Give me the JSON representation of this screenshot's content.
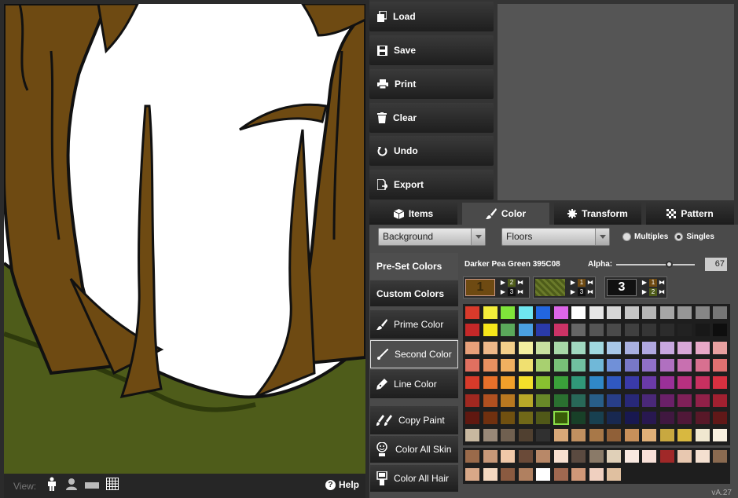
{
  "actions": {
    "load": "Load",
    "save": "Save",
    "print": "Print",
    "clear": "Clear",
    "undo": "Undo",
    "export": "Export"
  },
  "tabs": [
    {
      "label": "Items",
      "icon": "cube-icon"
    },
    {
      "label": "Color",
      "icon": "paint-brush-icon",
      "active": true
    },
    {
      "label": "Transform",
      "icon": "gear-icon"
    },
    {
      "label": "Pattern",
      "icon": "checker-pattern-icon"
    }
  ],
  "selects": {
    "layer": "Background",
    "category": "Floors"
  },
  "radios": {
    "multiples": "Multiples",
    "singles": "Singles",
    "selected": "Singles"
  },
  "side": {
    "preset": "Pre-Set Colors",
    "custom": "Custom Colors",
    "prime": "Prime Color",
    "second": "Second Color",
    "line": "Line Color",
    "copy": "Copy Paint",
    "skin": "Color All Skin",
    "hair": "Color All Hair"
  },
  "color_info": {
    "name": "Darker Pea Green 395C08",
    "alpha_label": "Alpha:",
    "alpha_value": "67",
    "alpha_fraction": 0.67
  },
  "slots": [
    "1",
    "2",
    "3"
  ],
  "view": {
    "label": "View:",
    "help": "Help"
  },
  "version": "vA.27",
  "colors": {
    "canvas_green": "#4e5c1a",
    "bark": "#6e4a12",
    "selected_swatch": "#395C08"
  },
  "palette_rows": [
    [
      "#d93a2b",
      "#f4ee3a",
      "#7fe53a",
      "#6fe7f0",
      "#2266e0",
      "#dd66e8",
      "#ffffff",
      "#e6e6e6",
      "#d6d6d6",
      "#c6c6c6",
      "#b6b6b6",
      "#a6a6a6",
      "#969696",
      "#868686",
      "#767676"
    ],
    [
      "#c62828",
      "#f6e61a",
      "#5aa85a",
      "#4aa0e0",
      "#2a3aa8",
      "#cc3366",
      "#666666",
      "#555555",
      "#4a4a4a",
      "#404040",
      "#363636",
      "#2c2c2c",
      "#222222",
      "#181818",
      "#0e0e0e"
    ],
    [
      "#e8a07a",
      "#eeb88a",
      "#f4d08a",
      "#f4f0a0",
      "#c8e0a0",
      "#a8d8a8",
      "#a0d8c0",
      "#a0d8e0",
      "#a8c8e8",
      "#a8b0e0",
      "#b0a8e0",
      "#c8a8e0",
      "#d8a8d8",
      "#e8a8c8",
      "#e8a0a0"
    ],
    [
      "#e07060",
      "#e89060",
      "#f0b060",
      "#f0e070",
      "#a8d070",
      "#78c078",
      "#70c0a0",
      "#70b8d8",
      "#7090d8",
      "#7878c8",
      "#9070c8",
      "#b070c0",
      "#c870b0",
      "#d87090",
      "#e07070"
    ],
    [
      "#d83a2a",
      "#e8702a",
      "#f0a02a",
      "#f4e02a",
      "#88c030",
      "#3aa03a",
      "#309878",
      "#3088c8",
      "#3058c0",
      "#3a3aa8",
      "#6a3aa8",
      "#9a3098",
      "#b83080",
      "#c83060",
      "#d83040"
    ],
    [
      "#a02820",
      "#b05020",
      "#b87820",
      "#b8a828",
      "#688828",
      "#2a7030",
      "#286858",
      "#285e88",
      "#283e88",
      "#282878",
      "#4a2878",
      "#6a2068",
      "#802058",
      "#902048",
      "#a02030"
    ],
    [
      "#601810",
      "#70300f",
      "#705010",
      "#706818",
      "#505818",
      "#395c08",
      "#184028",
      "#184050",
      "#182850",
      "#181850",
      "#281850",
      "#401840",
      "#501838",
      "#581828",
      "#601818"
    ],
    [
      "#c8b8a0",
      "#988878",
      "#706050",
      "#504030",
      "#303030",
      "#d8a878",
      "#c09060",
      "#a87848",
      "#906038",
      "#c8905a",
      "#e0b078",
      "#c8a840",
      "#d8b840",
      "#f0e8d0",
      "#f8f0e0"
    ]
  ],
  "palette_extra": [
    [
      "#9a6a4a",
      "#c89878",
      "#f0c8a8",
      "#6a4a38",
      "#b88868",
      "#f8e0d0",
      "#5a4a40",
      "#8a7a68",
      "#e0d0b8",
      "#f8e8e0",
      "#f8e0d8",
      "#a02828",
      "#e8c8b0",
      "#f4e0d0",
      "#8a6a50"
    ],
    [
      "#d8a888",
      "#f4d8c0",
      "#8a5a40",
      "#b08060",
      "#ffffff",
      "#a06850",
      "#d09878",
      "#f0d0c0",
      "#e0c0a0"
    ]
  ]
}
